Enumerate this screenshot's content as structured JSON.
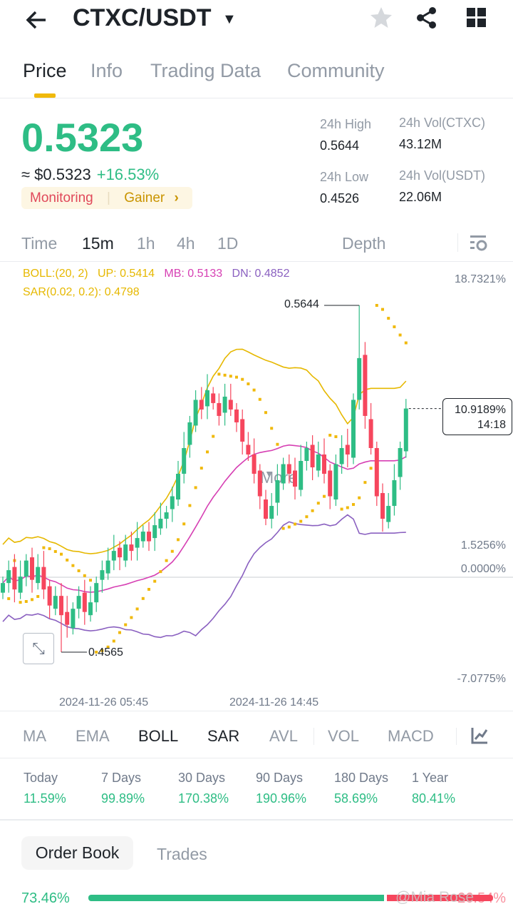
{
  "header": {
    "pair": "CTXC/USDT",
    "back_icon": "arrow-left",
    "star_icon": "star",
    "share_icon": "share",
    "grid_icon": "grid"
  },
  "tabs": [
    "Price",
    "Info",
    "Trading Data",
    "Community"
  ],
  "ticker": {
    "price": "0.5323",
    "usd": "≈ $0.5323",
    "change": "+16.53%",
    "tag1": "Monitoring",
    "tag2": "Gainer",
    "tag_arrow": "›",
    "high_label": "24h High",
    "high": "0.5644",
    "low_label": "24h Low",
    "low": "0.4526",
    "vol1_label": "24h Vol(CTXC)",
    "vol1": "43.12M",
    "vol2_label": "24h Vol(USDT)",
    "vol2": "22.06M"
  },
  "intervals": [
    "Time",
    "15m",
    "1h",
    "4h",
    "1D",
    "More",
    "Depth"
  ],
  "indicators": {
    "boll": "BOLL:(20, 2)",
    "up": "UP: 0.5414",
    "mb": "MB: 0.5133",
    "dn": "DN: 0.4852",
    "sar": "SAR(0.02, 0.2): 0.4798"
  },
  "chart": {
    "axis": [
      "18.7321%",
      "1.5256%",
      "0.0000%",
      "-7.0775%"
    ],
    "max_label": "0.5644",
    "min_label": "0.4565",
    "current_pct": "10.9189%",
    "current_time": "14:18",
    "dates": [
      "2024-11-26 05:45",
      "2024-11-26 14:45"
    ],
    "colors": {
      "up": "#2ebd85",
      "down": "#f6465d",
      "boll_up": "#e6b800",
      "mb": "#d63fb3",
      "dn": "#8a60c0",
      "sar": "#f0b90b"
    },
    "closes": [
      0.478,
      0.482,
      0.476,
      0.48,
      0.485,
      0.479,
      0.483,
      0.476,
      0.471,
      0.474,
      0.468,
      0.465,
      0.47,
      0.474,
      0.469,
      0.472,
      0.478,
      0.482,
      0.485,
      0.488,
      0.486,
      0.49,
      0.488,
      0.492,
      0.494,
      0.491,
      0.496,
      0.498,
      0.5,
      0.505,
      0.512,
      0.52,
      0.528,
      0.535,
      0.532,
      0.538,
      0.534,
      0.53,
      0.536,
      0.532,
      0.528,
      0.522,
      0.518,
      0.512,
      0.505,
      0.498,
      0.502,
      0.51,
      0.515,
      0.512,
      0.508,
      0.516,
      0.52,
      0.514,
      0.518,
      0.512,
      0.505,
      0.515,
      0.52,
      0.518,
      0.535,
      0.548,
      0.53,
      0.52,
      0.505,
      0.498,
      0.502,
      0.51,
      0.52,
      0.5323
    ]
  },
  "indicator_tabs": [
    "MA",
    "EMA",
    "BOLL",
    "SAR",
    "AVL",
    "VOL",
    "MACD"
  ],
  "periods": [
    {
      "l": "Today",
      "v": "11.59%"
    },
    {
      "l": "7 Days",
      "v": "99.89%"
    },
    {
      "l": "30 Days",
      "v": "170.38%"
    },
    {
      "l": "90 Days",
      "v": "190.96%"
    },
    {
      "l": "180 Days",
      "v": "58.69%"
    },
    {
      "l": "1 Year",
      "v": "80.41%"
    }
  ],
  "orderbook": {
    "tab1": "Order Book",
    "tab2": "Trades",
    "buy_pct": "73.46%",
    "sell_pct": "26.54%",
    "buy_ratio": 0.7346,
    "watermark": "@Mia Rose"
  }
}
